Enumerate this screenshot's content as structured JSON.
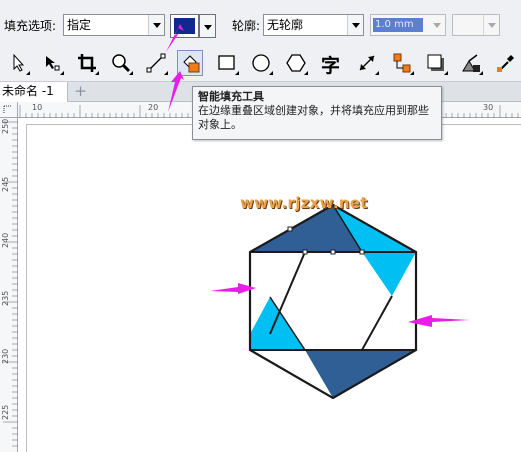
{
  "property_bar": {
    "fill_options_label": "填充选项:",
    "fill_options_value": "指定",
    "fill_color": "#0f2a8c",
    "outline_label": "轮廓:",
    "outline_value": "无轮廓",
    "outline_width_value": "1.0 mm"
  },
  "toolbox": {
    "tools": [
      {
        "icon": "pick-arrow-icon"
      },
      {
        "icon": "shape-tool-icon"
      },
      {
        "icon": "crop-tool-icon"
      },
      {
        "icon": "zoom-tool-icon"
      },
      {
        "icon": "freehand-line-icon"
      },
      {
        "icon": "smart-fill-icon",
        "active": true
      },
      {
        "icon": "rectangle-icon"
      },
      {
        "icon": "ellipse-icon"
      },
      {
        "icon": "polygon-icon"
      },
      {
        "icon": "text-tool-icon",
        "glyph": "字"
      },
      {
        "icon": "dimension-tool-icon"
      },
      {
        "icon": "connector-tool-icon"
      },
      {
        "icon": "drop-shadow-icon"
      },
      {
        "icon": "transparency-icon"
      },
      {
        "icon": "eyedropper-icon"
      }
    ]
  },
  "document_tab": {
    "title": "未命名 -1",
    "add_tab_label": "+"
  },
  "rulers": {
    "horizontal_ticks": [
      "10",
      "20",
      "30"
    ],
    "vertical_ticks": [
      "250",
      "245",
      "240",
      "235",
      "230",
      "225"
    ]
  },
  "tooltip": {
    "title": "智能填充工具",
    "description": "在边缘重叠区域创建对象，并将填充应用到那些对象上。"
  },
  "canvas": {
    "watermark": "www.rjzxw.net",
    "colors": {
      "dark_blue": "#2f5f94",
      "cyan": "#00bff3",
      "outline": "#1a1a1a",
      "arrow": "#e81ee8"
    }
  }
}
